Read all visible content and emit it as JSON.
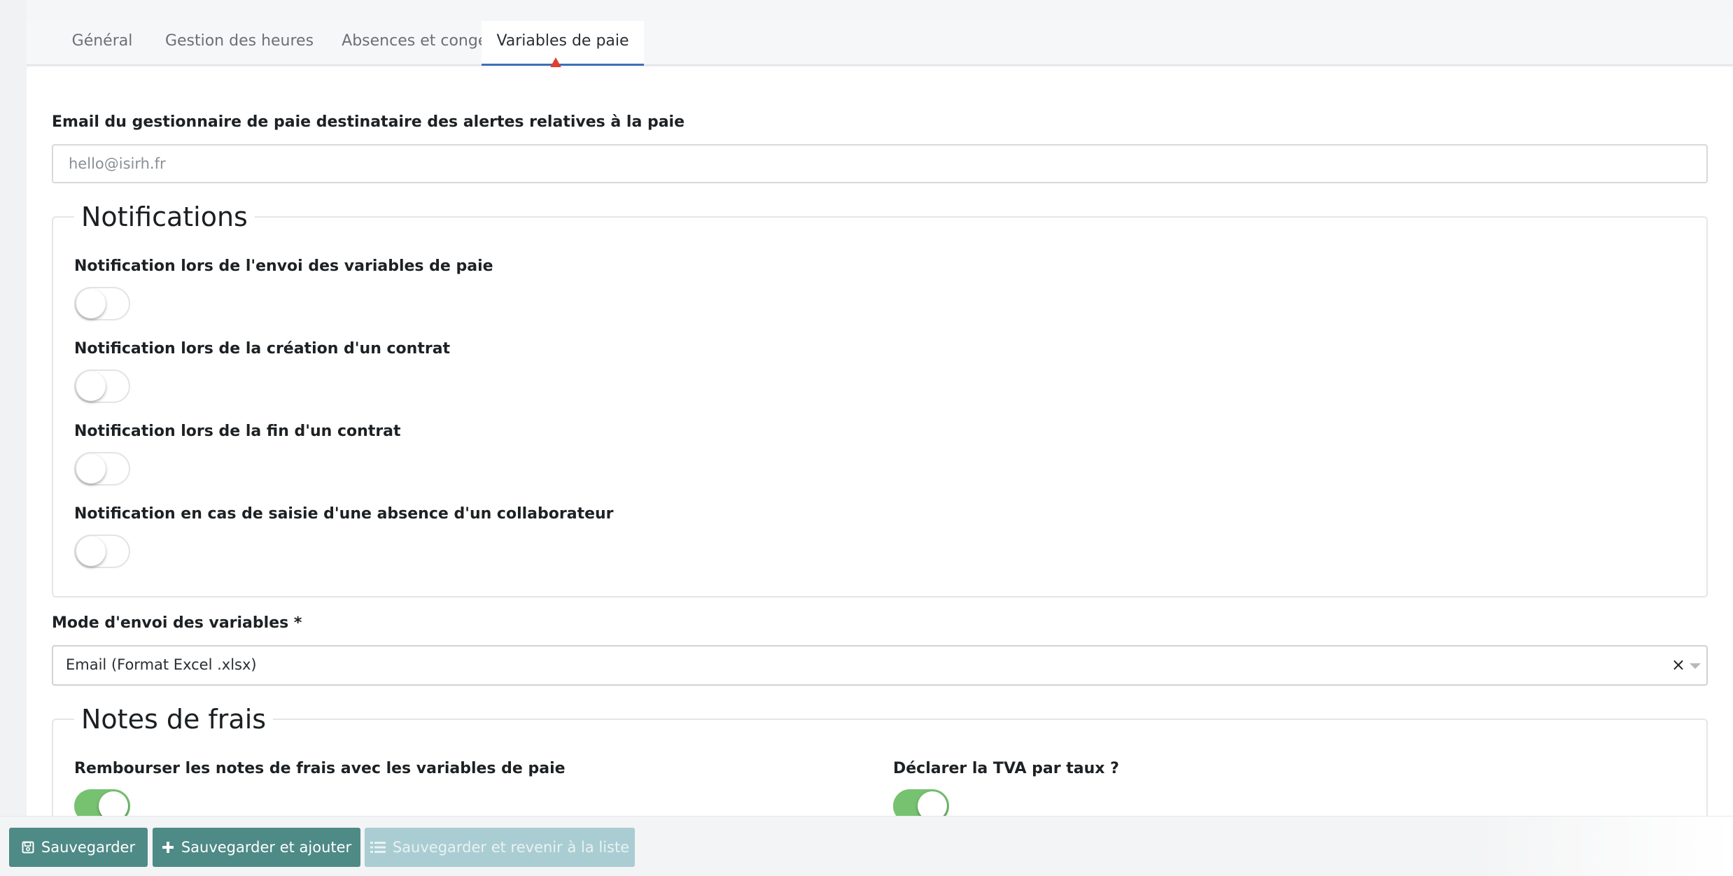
{
  "tabs": [
    {
      "label": "Général"
    },
    {
      "label": "Gestion des heures"
    },
    {
      "label": "Absences et congés"
    },
    {
      "label": "Variables de paie",
      "active": true
    }
  ],
  "email": {
    "label": "Email du gestionnaire de paie destinataire des alertes relatives à la paie",
    "placeholder": "hello@isirh.fr",
    "value": ""
  },
  "notifications": {
    "title": "Notifications",
    "items": [
      {
        "label": "Notification lors de l'envoi des variables de paie",
        "enabled": false
      },
      {
        "label": "Notification lors de la création d'un contrat",
        "enabled": false
      },
      {
        "label": "Notification lors de la fin d'un contrat",
        "enabled": false
      },
      {
        "label": "Notification en cas de saisie d'une absence d'un collaborateur",
        "enabled": false
      }
    ]
  },
  "send_mode": {
    "label": "Mode d'envoi des variables *",
    "value": "Email (Format Excel .xlsx)",
    "clear_symbol": "×"
  },
  "expenses": {
    "title": "Notes de frais",
    "reimburse": {
      "label": "Rembourser les notes de frais avec les variables de paie",
      "enabled": true
    },
    "vat": {
      "label": "Déclarer la TVA par taux ?",
      "enabled": true
    }
  },
  "footer": {
    "save": "Sauvegarder",
    "save_add": "Sauvegarder et ajouter",
    "save_back": "Sauvegarder et revenir à la liste"
  },
  "colors": {
    "accent_tab": "#3d6fb6",
    "annotation_arrow": "#e0402f",
    "toggle_on": "#76c271",
    "button_primary": "#4e8a86",
    "button_disabled": "#a9cdd2"
  },
  "icons": [
    "floppy-disk-icon",
    "plus-icon",
    "list-icon",
    "chevron-down-icon",
    "close-icon"
  ]
}
